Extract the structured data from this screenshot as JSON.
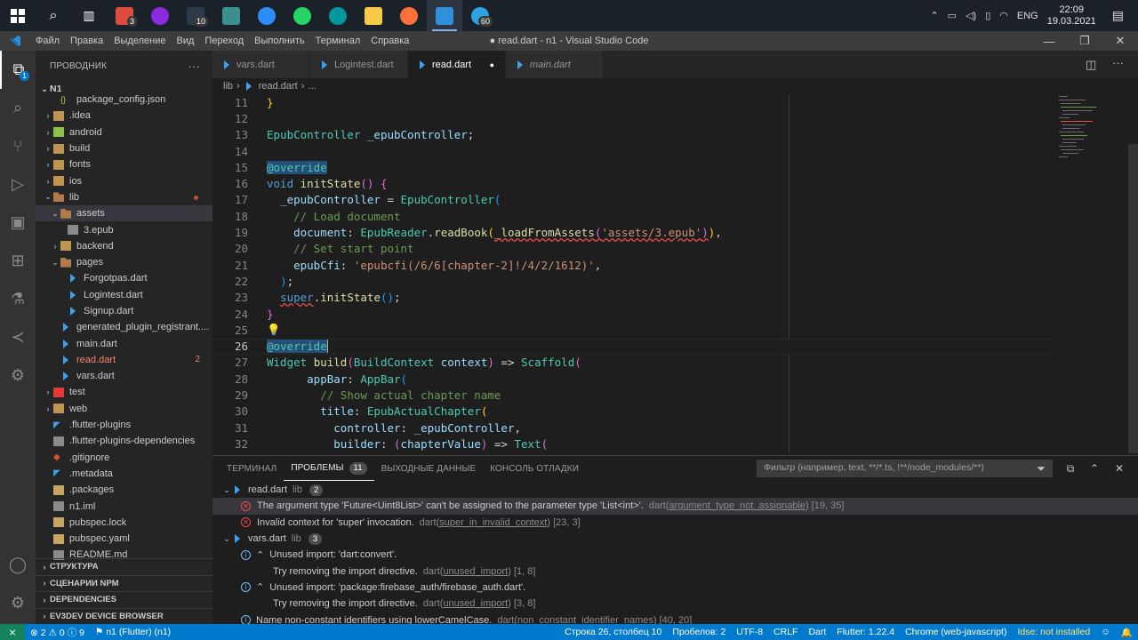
{
  "taskbar": {
    "apps": [
      {
        "name": "windows-start-icon",
        "color": "#ffffff"
      },
      {
        "name": "search-icon",
        "color": "#ffffff"
      },
      {
        "name": "task-view-icon",
        "color": "#ffffff"
      },
      {
        "name": "todoist-icon",
        "color": "#db4c3f",
        "badge": "3"
      },
      {
        "name": "app-purple-icon",
        "color": "#8a2be2"
      },
      {
        "name": "file-badge-icon",
        "color": "#2a3a4a",
        "badge": "10"
      },
      {
        "name": "tray-app-icon",
        "color": "#3a8f8f"
      },
      {
        "name": "zoom-icon",
        "color": "#2d8cff"
      },
      {
        "name": "whatsapp-icon",
        "color": "#25d366"
      },
      {
        "name": "arduino-icon",
        "color": "#00979d"
      },
      {
        "name": "file-explorer-icon",
        "color": "#f8c94a"
      },
      {
        "name": "firefox-icon",
        "color": "#ff7139"
      },
      {
        "name": "vscode-icon",
        "color": "#2f8fd8",
        "active": true
      },
      {
        "name": "telegram-icon",
        "color": "#2aa3df",
        "badge": "60"
      }
    ],
    "tray": {
      "lang": "ENG",
      "time": "22:09",
      "date": "19.03.2021"
    }
  },
  "menubar": {
    "items": [
      "Файл",
      "Правка",
      "Выделение",
      "Вид",
      "Переход",
      "Выполнить",
      "Терминал",
      "Справка"
    ],
    "title": "● read.dart - n1 - Visual Studio Code"
  },
  "sidebar": {
    "title": "ПРОВОДНИК",
    "root": "N1",
    "tree": [
      {
        "label": "package_config.json",
        "indent": 2,
        "icon": "gear",
        "partial": true
      },
      {
        "label": ".idea",
        "indent": 1,
        "icon": "folder",
        "chev": "›"
      },
      {
        "label": "android",
        "indent": 1,
        "icon": "folder-android",
        "chev": "›"
      },
      {
        "label": "build",
        "indent": 1,
        "icon": "folder",
        "chev": "›"
      },
      {
        "label": "fonts",
        "indent": 1,
        "icon": "folder",
        "chev": "›"
      },
      {
        "label": "ios",
        "indent": 1,
        "icon": "folder",
        "chev": "›"
      },
      {
        "label": "lib",
        "indent": 1,
        "icon": "folder-open",
        "chev": "⌄",
        "dot": true
      },
      {
        "label": "assets",
        "indent": 2,
        "icon": "folder-open",
        "chev": "⌄",
        "selected": true
      },
      {
        "label": "3.epub",
        "indent": 3,
        "icon": "file"
      },
      {
        "label": "backend",
        "indent": 2,
        "icon": "folder",
        "chev": "›"
      },
      {
        "label": "pages",
        "indent": 2,
        "icon": "folder-open",
        "chev": "⌄"
      },
      {
        "label": "Forgotpas.dart",
        "indent": 3,
        "icon": "dart"
      },
      {
        "label": "Logintest.dart",
        "indent": 3,
        "icon": "dart"
      },
      {
        "label": "Signup.dart",
        "indent": 3,
        "icon": "dart"
      },
      {
        "label": "generated_plugin_registrant....",
        "indent": 2,
        "icon": "dart"
      },
      {
        "label": "main.dart",
        "indent": 2,
        "icon": "dart"
      },
      {
        "label": "read.dart",
        "indent": 2,
        "icon": "dart",
        "error": true,
        "badge": "2"
      },
      {
        "label": "vars.dart",
        "indent": 2,
        "icon": "dart"
      },
      {
        "label": "test",
        "indent": 1,
        "icon": "folder-test",
        "chev": "›"
      },
      {
        "label": "web",
        "indent": 1,
        "icon": "folder",
        "chev": "›"
      },
      {
        "label": ".flutter-plugins",
        "indent": 1,
        "icon": "flutter"
      },
      {
        "label": ".flutter-plugins-dependencies",
        "indent": 1,
        "icon": "file"
      },
      {
        "label": ".gitignore",
        "indent": 1,
        "icon": "git"
      },
      {
        "label": ".metadata",
        "indent": 1,
        "icon": "flutter"
      },
      {
        "label": ".packages",
        "indent": 1,
        "icon": "folder"
      },
      {
        "label": "n1.iml",
        "indent": 1,
        "icon": "file"
      },
      {
        "label": "pubspec.lock",
        "indent": 1,
        "icon": "folder"
      },
      {
        "label": "pubspec.yaml",
        "indent": 1,
        "icon": "folder"
      },
      {
        "label": "README.md",
        "indent": 1,
        "icon": "md"
      }
    ],
    "sections": [
      "СТРУКТУРА",
      "СЦЕНАРИИ NPM",
      "DEPENDENCIES",
      "EV3DEV DEVICE BROWSER"
    ]
  },
  "tabs": [
    {
      "label": "vars.dart",
      "active": false
    },
    {
      "label": "Logintest.dart",
      "active": false
    },
    {
      "label": "read.dart",
      "active": true,
      "dirty": true
    },
    {
      "label": "main.dart",
      "active": false,
      "italic": true
    }
  ],
  "breadcrumb": [
    "lib",
    "read.dart",
    "..."
  ],
  "editor": {
    "current_line": 26,
    "lines": [
      {
        "n": 11,
        "html": "<span class='br'>}</span>"
      },
      {
        "n": 12,
        "html": ""
      },
      {
        "n": 13,
        "html": "<span class='ty'>EpubController</span> <span class='vr'>_epubController</span>;"
      },
      {
        "n": 14,
        "html": ""
      },
      {
        "n": 15,
        "html": "<span class='hl'><span class='ty'>@override</span></span>"
      },
      {
        "n": 16,
        "html": "<span class='kw'>void</span> <span class='fn'>initState</span><span class='br2'>()</span> <span class='br2'>{</span>"
      },
      {
        "n": 17,
        "html": "  <span class='vr'>_epubController</span> = <span class='ty'>EpubController</span><span class='br3'>(</span>"
      },
      {
        "n": 18,
        "html": "    <span class='cm'>// Load document</span>"
      },
      {
        "n": 19,
        "html": "    <span class='vr'>document</span>: <span class='ty'>EpubReader</span>.<span class='fn'>readBook</span><span class='br'>(</span><span class='squig'><span class='fn'>_loadFromAssets</span><span class='br2'>(</span><span class='st'>'assets/3.epub'</span><span class='br2'>)</span></span><span class='br'>)</span>,"
      },
      {
        "n": 20,
        "html": "    <span class='cm'>// Set start point</span>"
      },
      {
        "n": 21,
        "html": "    <span class='vr'>epubCfi</span>: <span class='st'>'epubcfi(/6/6[chapter-2]!/4/2/1612)'</span>,"
      },
      {
        "n": 22,
        "html": "  <span class='br3'>)</span>;"
      },
      {
        "n": 23,
        "html": "  <span class='squig'><span class='kw'>super</span></span>.<span class='fn'>initState</span><span class='br3'>()</span>;"
      },
      {
        "n": 24,
        "html": "<span class='br2'>}</span>"
      },
      {
        "n": 25,
        "html": "<span style='color:#ffcc00'>💡</span>",
        "bulb": true
      },
      {
        "n": 26,
        "html": "<span class='hl'><span class='ty'>@override</span></span><span style='border-left:1px solid #aeafad'></span>"
      },
      {
        "n": 27,
        "html": "<span class='ty'>Widget</span> <span class='fn'>build</span><span class='br2'>(</span><span class='ty'>BuildContext</span> <span class='vr'>context</span><span class='br2'>)</span> => <span class='ty'>Scaffold</span><span class='br2'>(</span>"
      },
      {
        "n": 28,
        "html": "      <span class='vr'>appBar</span>: <span class='ty'>AppBar</span><span class='br3'>(</span>"
      },
      {
        "n": 29,
        "html": "        <span class='cm'>// Show actual chapter name</span>"
      },
      {
        "n": 30,
        "html": "        <span class='vr'>title</span>: <span class='ty'>EpubActualChapter</span><span class='br'>(</span>"
      },
      {
        "n": 31,
        "html": "          <span class='vr'>controller</span>: <span class='vr'>_epubController</span>,"
      },
      {
        "n": 32,
        "html": "          <span class='vr'>builder</span>: <span class='br2'>(</span><span class='vr'>chapterValue</span><span class='br2'>)</span> => <span class='ty'>Text</span><span class='br2'>(</span>"
      }
    ]
  },
  "panel": {
    "tabs": [
      {
        "label": "ТЕРМИНАЛ",
        "active": false
      },
      {
        "label": "ПРОБЛЕМЫ",
        "active": true,
        "count": "11"
      },
      {
        "label": "ВЫХОДНЫЕ ДАННЫЕ",
        "active": false
      },
      {
        "label": "КОНСОЛЬ ОТЛАДКИ",
        "active": false
      }
    ],
    "filter_placeholder": "Фильтр (например, text, **/*.ts, !**/node_modules/**)",
    "groups": [
      {
        "file": "read.dart",
        "dir": "lib",
        "count": "2",
        "items": [
          {
            "type": "error",
            "msg": "The argument type 'Future<Uint8List>' can't be assigned to the parameter type 'List<int>'.",
            "src": "dart(",
            "code": "argument_type_not_assignable",
            "pos": ") [19, 35]",
            "selected": true
          },
          {
            "type": "error",
            "msg": "Invalid context for 'super' invocation.",
            "src": "dart(",
            "code": "super_in_invalid_context",
            "pos": ") [23, 3]"
          }
        ]
      },
      {
        "file": "vars.dart",
        "dir": "lib",
        "count": "3",
        "items": [
          {
            "type": "info",
            "msg": "Unused import: 'dart:convert'.",
            "sub": "Try removing the import directive.",
            "src": "dart(",
            "code": "unused_import",
            "pos": ") [1, 8]"
          },
          {
            "type": "info",
            "msg": "Unused import: 'package:firebase_auth/firebase_auth.dart'.",
            "sub": "Try removing the import directive.",
            "src": "dart(",
            "code": "unused_import",
            "pos": ") [3, 8]"
          },
          {
            "type": "info",
            "msg": "Name non-constant identifiers using lowerCamelCase.",
            "src": "dart(",
            "code": "non_constant_identifier_names",
            "pos": ") [40, 20]"
          }
        ]
      }
    ]
  },
  "statusbar": {
    "remote": "⨯",
    "errors": "2",
    "warnings": "0",
    "infos": "9",
    "project": "n1 (Flutter) (n1)",
    "position": "Строка 26, столбец 10",
    "spaces": "Пробелов: 2",
    "encoding": "UTF-8",
    "eol": "CRLF",
    "language": "Dart",
    "flutter": "Flutter: 1.22.4",
    "device": "Chrome (web-javascript)",
    "idse": "Idse: not installed"
  },
  "colors": {
    "accent": "#007acc",
    "error": "#f14c4c",
    "info": "#75beff"
  }
}
